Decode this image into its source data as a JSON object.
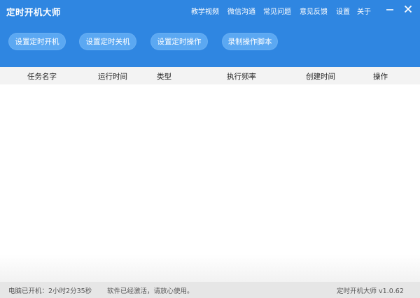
{
  "window": {
    "title": "定时开机大师"
  },
  "nav": {
    "items": [
      "教学视频",
      "微信沟通",
      "常见问题",
      "意见反馈",
      "设置",
      "关于"
    ]
  },
  "window_controls": {
    "minimize_icon": "minimize-icon",
    "close_icon": "close-icon"
  },
  "toolbar": {
    "buttons": [
      "设置定时开机",
      "设置定时关机",
      "设置定时操作",
      "录制操作脚本"
    ]
  },
  "table": {
    "columns": [
      "任务名字",
      "运行时间",
      "类型",
      "执行频率",
      "创建时间",
      "操作"
    ],
    "rows": []
  },
  "status": {
    "uptime": "电脑已开机：2小时2分35秒",
    "activation": "软件已经激活，请放心使用。",
    "version": "定时开机大师 v1.0.62"
  },
  "colors": {
    "header_bg": "#2f86e1",
    "button_bg": "#5ba8f2",
    "table_header_bg": "#f3f3f3",
    "status_bar_bg": "#e6e6e6"
  }
}
